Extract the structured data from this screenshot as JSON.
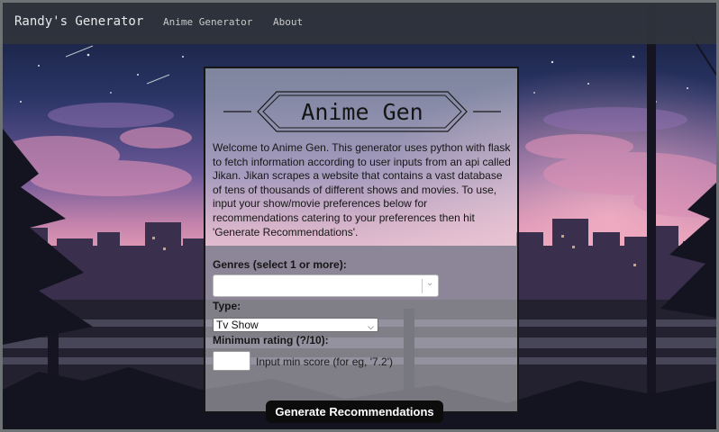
{
  "nav": {
    "brand": "Randy's Generator",
    "links": [
      "Anime Generator",
      "About"
    ]
  },
  "card": {
    "title": "Anime Gen",
    "intro": "Welcome to Anime Gen. This generator uses python with flask to fetch information according to user inputs from an api called Jikan. Jikan scrapes a website that contains a vast database of tens of thousands of different shows and movies. To use, input your show/movie preferences below for recommendations catering to your preferences then hit 'Generate Recommendations'.",
    "genres_label": "Genres (select 1 or more):",
    "genres_value": "",
    "type_label": "Type:",
    "type_value": "Tv Show",
    "rating_label": "Minimum rating (?/10):",
    "rating_value": "",
    "rating_hint": "Input min score (for eg, '7.2')",
    "submit_label": "Generate Recommendations"
  },
  "colors": {
    "navbar": "#30343c",
    "card_border": "#161616",
    "button_bg": "#0c0c0c",
    "sky_top": "#16213f",
    "sky_mid": "#6c4e8c",
    "horizon": "#e49ab4"
  },
  "icons": [
    "chevron-down-icon"
  ]
}
